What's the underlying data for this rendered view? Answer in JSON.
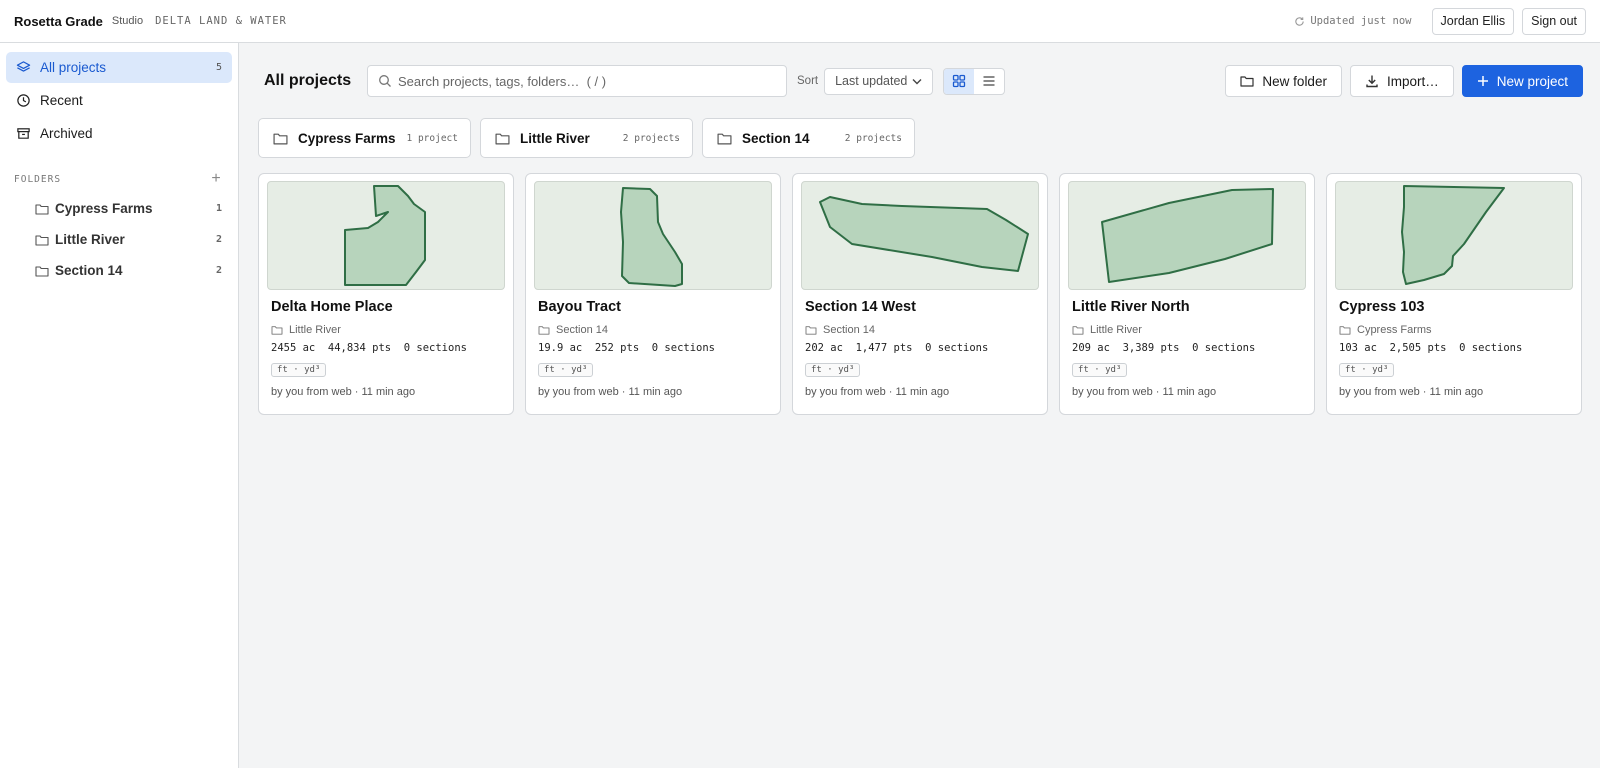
{
  "header": {
    "brand": "Rosetta Grade",
    "brand_sub": "Studio",
    "org": "DELTA LAND & WATER",
    "status": "Updated just now",
    "user": "Jordan Ellis",
    "sign_out": "Sign out"
  },
  "sidebar": {
    "items": [
      {
        "label": "All projects",
        "count": "5"
      },
      {
        "label": "Recent"
      },
      {
        "label": "Archived"
      }
    ],
    "folders_title": "FOLDERS",
    "folders": [
      {
        "label": "Cypress Farms",
        "count": "1"
      },
      {
        "label": "Little River",
        "count": "2"
      },
      {
        "label": "Section 14",
        "count": "2"
      }
    ]
  },
  "toolbar": {
    "title": "All projects",
    "search_placeholder": "Search projects, tags, folders…  ( / )",
    "sort_label": "Sort",
    "sort_value": "Last updated",
    "new_folder": "New folder",
    "import": "Import…",
    "new_project": "New project"
  },
  "folder_cards": [
    {
      "name": "Cypress Farms",
      "count": "1 project"
    },
    {
      "name": "Little River",
      "count": "2 projects"
    },
    {
      "name": "Section 14",
      "count": "2 projects"
    }
  ],
  "projects": [
    {
      "name": "Delta Home Place",
      "folder": "Little River",
      "stats": "2455 ac  44,834 pts  0 sections",
      "units": "ft · yd³",
      "meta": "by you from web · 11 min ago"
    },
    {
      "name": "Bayou Tract",
      "folder": "Section 14",
      "stats": "19.9 ac  252 pts  0 sections",
      "units": "ft · yd³",
      "meta": "by you from web · 11 min ago"
    },
    {
      "name": "Section 14 West",
      "folder": "Section 14",
      "stats": "202 ac  1,477 pts  0 sections",
      "units": "ft · yd³",
      "meta": "by you from web · 11 min ago"
    },
    {
      "name": "Little River North",
      "folder": "Little River",
      "stats": "209 ac  3,389 pts  0 sections",
      "units": "ft · yd³",
      "meta": "by you from web · 11 min ago"
    },
    {
      "name": "Cypress 103",
      "folder": "Cypress Farms",
      "stats": "103 ac  2,505 pts  0 sections",
      "units": "ft · yd³",
      "meta": "by you from web · 11 min ago"
    }
  ],
  "colors": {
    "accent": "#1d63e0",
    "active_bg": "#dbe8fb",
    "field_fill": "#b7d4bc",
    "field_stroke": "#2f6e45"
  }
}
